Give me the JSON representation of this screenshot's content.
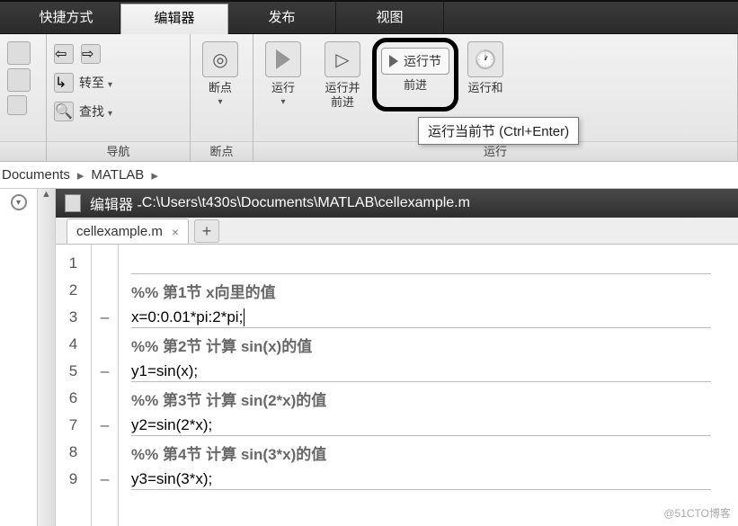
{
  "ribbon": {
    "tabs": {
      "shortcut": "快捷方式",
      "editor": "编辑器",
      "publish": "发布",
      "view": "视图"
    },
    "nav": {
      "goto": "转至",
      "find": "查找",
      "group_label": "导航"
    },
    "breakpoints": {
      "label": "断点",
      "group_label": "断点"
    },
    "run": {
      "run": "运行",
      "run_advance": "运行并\n前进",
      "run_section": "运行节",
      "advance": "前进",
      "run_and": "运行和",
      "group_label": "运行"
    }
  },
  "tooltip": {
    "text": "运行当前节 (Ctrl+Enter)"
  },
  "breadcrumb": {
    "seg1": "Documents",
    "seg2": "MATLAB"
  },
  "editor": {
    "title_prefix": "编辑器 - ",
    "title_path": "C:\\Users\\t430s\\Documents\\MATLAB\\cellexample.m",
    "tab_name": "cellexample.m",
    "lines": {
      "l1": "",
      "l2": "%% 第1节 x向里的值",
      "l3": "x=0:0.01*pi:2*pi;",
      "l4": "%% 第2节 计算 sin(x)的值",
      "l5": "y1=sin(x);",
      "l6": "%% 第3节 计算 sin(2*x)的值",
      "l7": "y2=sin(2*x);",
      "l8": "%% 第4节 计算 sin(3*x)的值",
      "l9": "y3=sin(3*x);"
    },
    "bp": {
      "dash": "–"
    }
  },
  "watermark": "@51CTO博客"
}
